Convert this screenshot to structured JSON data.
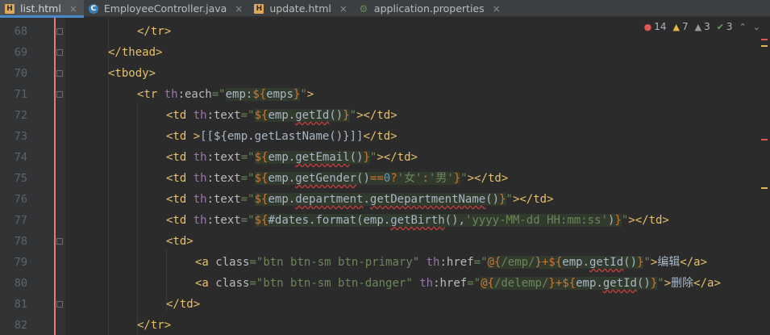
{
  "tabs": [
    {
      "label": "list.html",
      "icon": "html-file-icon",
      "active": true
    },
    {
      "label": "EmployeeController.java",
      "icon": "java-class-icon",
      "active": false
    },
    {
      "label": "update.html",
      "icon": "html-file-icon",
      "active": false
    },
    {
      "label": "application.properties",
      "icon": "properties-file-icon",
      "active": false
    }
  ],
  "close_glyph": "×",
  "inspections": {
    "errors": "14",
    "warnings": "7",
    "weak_warnings": "3",
    "typos": "3"
  },
  "line_numbers": [
    "68",
    "69",
    "70",
    "71",
    "72",
    "73",
    "74",
    "75",
    "76",
    "77",
    "78",
    "79",
    "80",
    "81",
    "82"
  ],
  "code": {
    "l68": {
      "t1": "</tr>"
    },
    "l69": {
      "t1": "</thead>"
    },
    "l70": {
      "t1": "<tbody>"
    },
    "l71": {
      "t1": "<tr ",
      "ns": "th",
      "attr": ":each",
      "eq": "=",
      "q1": "\"",
      "e1": "emp:",
      "e2": "${",
      "e3": "emps",
      "e4": "}",
      "q2": "\"",
      "t2": ">"
    },
    "l72": {
      "t1": "<td ",
      "ns": "th",
      "attr": ":text",
      "eq": "=",
      "q1": "\"",
      "e1": "${",
      "e2": "emp.",
      "e3": "getId",
      "e4": "()",
      "e5": "}",
      "q2": "\"",
      "t2": "></td>"
    },
    "l73": {
      "t1": "<td ",
      "t2": ">",
      "body": "[[${emp.getLastName()}]]",
      "t3": "</td>"
    },
    "l74": {
      "t1": "<td ",
      "ns": "th",
      "attr": ":text",
      "eq": "=",
      "q1": "\"",
      "e1": "${",
      "e2": "emp.",
      "e3": "getEmail",
      "e4": "()",
      "e5": "}",
      "q2": "\"",
      "t2": "></td>"
    },
    "l75": {
      "t1": "<td ",
      "ns": "th",
      "attr": ":text",
      "eq": "=",
      "q1": "\"",
      "e1": "${",
      "e2": "emp.",
      "e3": "getGender",
      "e4": "()",
      "e5": "==",
      "e6": "0",
      "e7": "?",
      "e8": "'女'",
      "e9": ":",
      "e10": "'男'",
      "e11": "}",
      "q2": "\"",
      "t2": "></td>"
    },
    "l76": {
      "t1": "<td ",
      "ns": "th",
      "attr": ":text",
      "eq": "=",
      "q1": "\"",
      "e1": "${",
      "e2": "emp.",
      "e3": "department",
      "e4": ".",
      "e5": "getDepartmentName",
      "e6": "()",
      "e7": "}",
      "q2": "\"",
      "t2": "></td>"
    },
    "l77": {
      "t1": "<td ",
      "ns": "th",
      "attr": ":text",
      "eq": "=",
      "q1": "\"",
      "e1": "${",
      "e2": "#dates.",
      "e3": "format",
      "e4": "(emp.",
      "e5": "getBirth",
      "e6": "(),",
      "e7": "'yyyy-MM-dd HH:mm:ss'",
      "e8": ")",
      "e9": "}",
      "q2": "\"",
      "t2": "></td>"
    },
    "l78": {
      "t1": "<td>"
    },
    "l79": {
      "t1": "<a ",
      "a1": "class",
      "eq1": "=",
      "s1": "\"btn btn-sm btn-primary\"",
      "sp": " ",
      "ns": "th",
      "a2": ":href",
      "eq2": "=",
      "q1": "\"",
      "e1": "@{",
      "e2": "/emp/",
      "e3": "}",
      "e4": "+",
      "e5": "${",
      "e6": "emp.",
      "e7": "getId",
      "e8": "()",
      "e9": "}",
      "q2": "\"",
      "t2": ">",
      "body": "编辑",
      "t3": "</a>"
    },
    "l80": {
      "t1": "<a ",
      "a1": "class",
      "eq1": "=",
      "s1": "\"btn btn-sm btn-danger\"",
      "sp": " ",
      "ns": "th",
      "a2": ":href",
      "eq2": "=",
      "q1": "\"",
      "e1": "@{",
      "e2": "/delemp/",
      "e3": "}",
      "e4": "+",
      "e5": "${",
      "e6": "emp.",
      "e7": "getId",
      "e8": "()",
      "e9": "}",
      "q2": "\"",
      "t2": ">",
      "body": "删除",
      "t3": "</a>"
    },
    "l81": {
      "t1": "</td>"
    },
    "l82": {
      "t1": "</tr>"
    }
  },
  "colors": {
    "background": "#2b2b2b",
    "gutter": "#313335",
    "tag": "#e8bf6a",
    "string": "#6a8759",
    "namespace": "#9876aa",
    "keyword": "#cc7832",
    "number": "#6897bb",
    "tab_accent": "#4a88c7",
    "error": "#e05555",
    "warning": "#e0b94a"
  }
}
